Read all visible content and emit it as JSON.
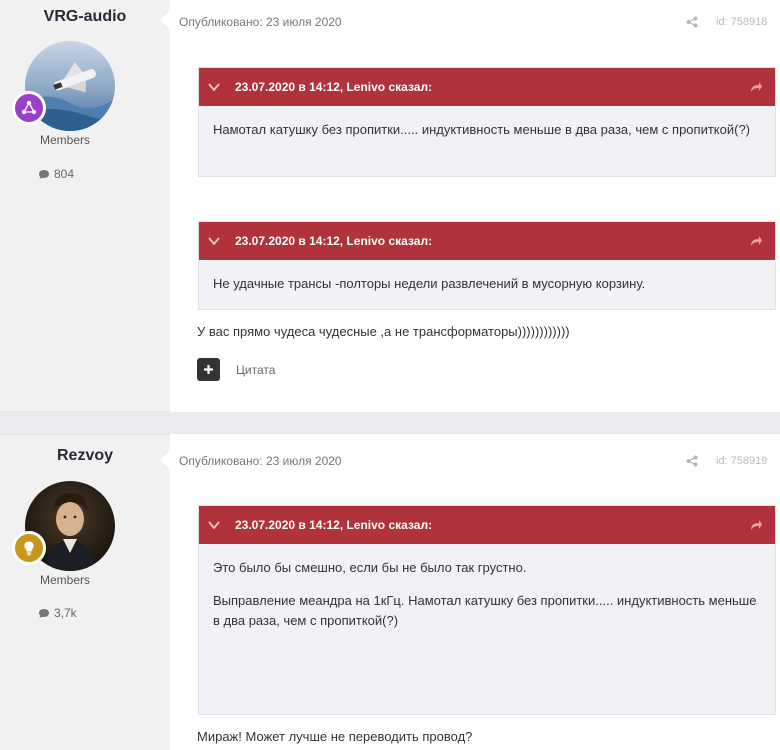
{
  "posts": [
    {
      "author": "VRG-audio",
      "group": "Members",
      "post_count": "804",
      "published": "Опубликовано: 23 июля 2020",
      "post_id": "id: 758918",
      "quotes": [
        {
          "header": "23.07.2020 в 14:12, Lenivo сказал:",
          "paragraphs": [
            "Намотал катушку без пропитки..... индуктивность меньше в два раза, чем с пропиткой(?)"
          ]
        },
        {
          "header": "23.07.2020 в 14:12, Lenivo сказал:",
          "paragraphs": [
            "Не удачные трансы -полторы недели развлечений в мусорную корзину."
          ]
        }
      ],
      "text": "У вас прямо чудеса чудесные ,а не трансформаторы))))))))))))",
      "cite_label": "Цитата"
    },
    {
      "author": "Rezvoy",
      "group": "Members",
      "post_count": "3,7k",
      "published": "Опубликовано: 23 июля 2020",
      "post_id": "id: 758919",
      "quotes": [
        {
          "header": "23.07.2020 в 14:12, Lenivo сказал:",
          "paragraphs": [
            "Это было бы смешно, если бы не было так грустно.",
            "Выправление меандра на 1кГц. Намотал катушку без пропитки..... индуктивность меньше в два раза, чем с пропиткой(?)"
          ]
        }
      ],
      "text": "Мираж!  Может лучше не переводить провод?"
    }
  ],
  "colors": {
    "quote_header": "#b0323a",
    "quote_body": "#f1f2f6",
    "badge_post1": "#9b3fc9",
    "badge_post2": "#c9961d"
  }
}
